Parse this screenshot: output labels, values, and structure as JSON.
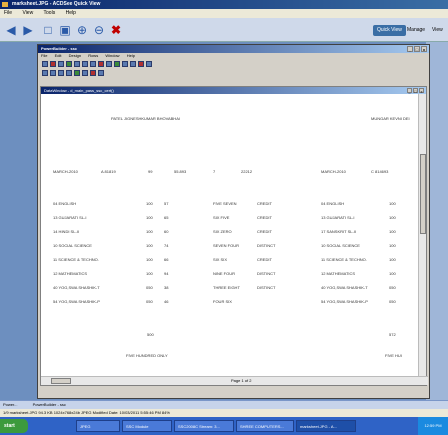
{
  "acdsee": {
    "title": "marksheet.JPG - ACDSee Quick View",
    "menu": [
      "File",
      "View",
      "Tools",
      "Help"
    ],
    "modes": [
      "Quick View",
      "Manage",
      "View"
    ]
  },
  "powerbuilder": {
    "title": "PowerBuilder - ssc",
    "menu": [
      "File",
      "Edit",
      "Design",
      "Rows",
      "Window",
      "Help"
    ],
    "datawindow_title": "DataWindow - d_main_pass_ssc_cert()",
    "page_info": "Page 1 of 2"
  },
  "marksheet": {
    "student_name": "PATEL JIGNESHKUMAR BHOVABHAI",
    "school": "MUNGAR KEVNI DEI",
    "exam": "MARCH-2010",
    "seat_no": "A 81819",
    "col3": "99",
    "col4": "55.893",
    "col5": "7",
    "col6": "22212",
    "exam_right": "MARCH-2010",
    "seat_right": "C 814693",
    "subjects": [
      {
        "name": "04 ENGLISH",
        "max": "100",
        "marks": "57",
        "words": "FIVE SEVEN",
        "result": "CREDIT",
        "rname": "04 ENGLISH",
        "rmax": "100"
      },
      {
        "name": "13 GUJARATI SL-I",
        "max": "100",
        "marks": "65",
        "words": "SIX FIVE",
        "result": "CREDIT",
        "rname": "13 GUJARATI SL-I",
        "rmax": "100"
      },
      {
        "name": "14 HINDI SL-II",
        "max": "100",
        "marks": "60",
        "words": "SIX ZERO",
        "result": "CREDIT",
        "rname": "17 SANSKRIT SL-II",
        "rmax": "100"
      },
      {
        "name": "10 SOCIAL SCIENCE",
        "max": "100",
        "marks": "74",
        "words": "SEVEN FOUR",
        "result": "DISTINCT",
        "rname": "10 SOCIAL SCIENCE",
        "rmax": "100"
      },
      {
        "name": "11 SCIENCE & TECHNO.",
        "max": "100",
        "marks": "66",
        "words": "SIX SIX",
        "result": "CREDIT",
        "rname": "11 SCIENCE & TECHNO.",
        "rmax": "100"
      },
      {
        "name": "12 MATHEMATICS",
        "max": "100",
        "marks": "94",
        "words": "NINE FOUR",
        "result": "DISTINCT",
        "rname": "12 MATHEMATICS",
        "rmax": "100"
      },
      {
        "name": "40 YOG,SWA SHASHIK-T",
        "max": "050",
        "marks": "38",
        "words": "THREE EIGHT",
        "result": "DISTINCT",
        "rname": "40 YOG,SWA SHASHIK-T",
        "rmax": "050"
      },
      {
        "name": "54 YOG,SWA SHASHIK-P",
        "max": "050",
        "marks": "46",
        "words": "FOUR SIX",
        "result": "",
        "rname": "54 YOG,SWA SHASHIK-P",
        "rmax": "050"
      }
    ],
    "total_max": "500",
    "total_words": "FIVE HUNDRED ONLY",
    "total_right": "572",
    "total_words_right": "FIVE HUI"
  },
  "status_bar": {
    "text": "1/9   marksheet.JPG  94.3 KB  1024x768x24b JPEG  Modified Date: 10/03/2011 5:55:46 PM  84%"
  },
  "taskbar": {
    "start": "start",
    "tasks": [
      "Power...",
      "PowerBuilder - ssc",
      "JPEG",
      "SSC Module",
      "SSC2008C Stream: 3...",
      "SHREE COMPUTERS...",
      "marksheet.JPG - A..."
    ],
    "clock": "12:59 PM"
  }
}
